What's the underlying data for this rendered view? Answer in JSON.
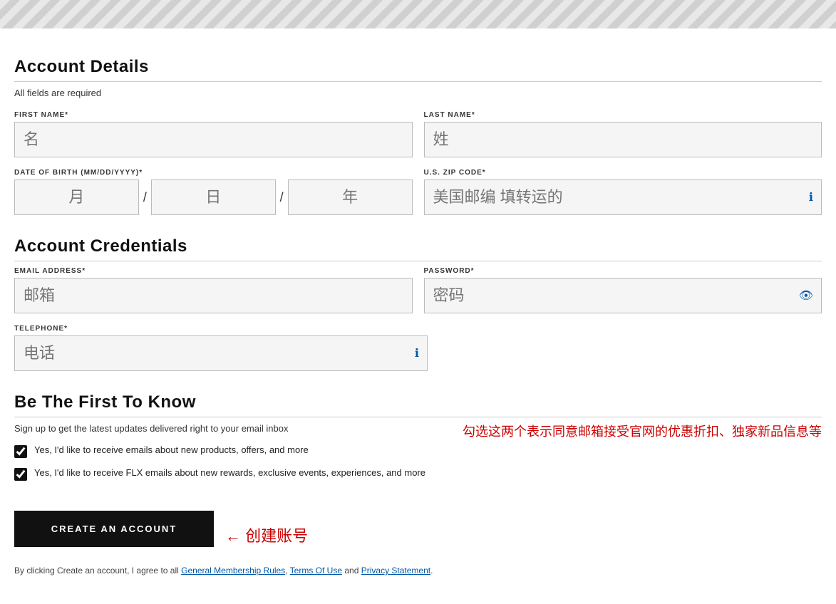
{
  "topBanner": {
    "visible": true
  },
  "accountDetails": {
    "title": "Account Details",
    "divider": true,
    "subtitle": "All fields are required",
    "firstNameLabel": "FIRST NAME*",
    "firstNamePlaceholder": "名",
    "lastNameLabel": "LAST NAME*",
    "lastNamePlaceholder": "姓",
    "dobLabel": "DATE OF BIRTH (MM/DD/YYYY)*",
    "dobMonthPlaceholder": "月",
    "dobDayPlaceholder": "日",
    "dobYearPlaceholder": "年",
    "zipLabel": "U.S. ZIP CODE*",
    "zipPlaceholder": "美国邮编 填转运的",
    "zipHelp": "ℹ"
  },
  "accountCredentials": {
    "title": "Account Credentials",
    "emailLabel": "EMAIL ADDRESS*",
    "emailPlaceholder": "邮箱",
    "passwordLabel": "PASSWORD*",
    "passwordPlaceholder": "密码",
    "passwordShowIcon": "👁",
    "telephoneLabel": "TELEPHONE*",
    "telephonePlaceholder": "电话",
    "telephoneHelp": "ℹ"
  },
  "beFirst": {
    "title": "Be The First To Know",
    "subtitle": "Sign up to get the latest updates delivered right to your email inbox",
    "annotation": "勾选这两个表示同意邮箱接受官网的优惠折扣、独家新品信息等",
    "checkbox1Label": "Yes, I'd like to receive emails about new products, offers, and more",
    "checkbox1Checked": true,
    "checkbox2Label": "Yes, I'd like to receive FLX emails about new rewards, exclusive events, experiences, and more",
    "checkbox2Checked": true
  },
  "createAccount": {
    "buttonLabel": "CREATE AN ACCOUNT",
    "arrowAnnotation": "← 创建账号",
    "termsPrefix": "By clicking Create an account, I agree to all",
    "termsLink1": "General Membership Rules",
    "termsSeparator1": ",",
    "termsLink2": "Terms Of Use",
    "termsConnector": "and",
    "termsLink3": "Privacy Statement",
    "termsSuffix": "."
  }
}
